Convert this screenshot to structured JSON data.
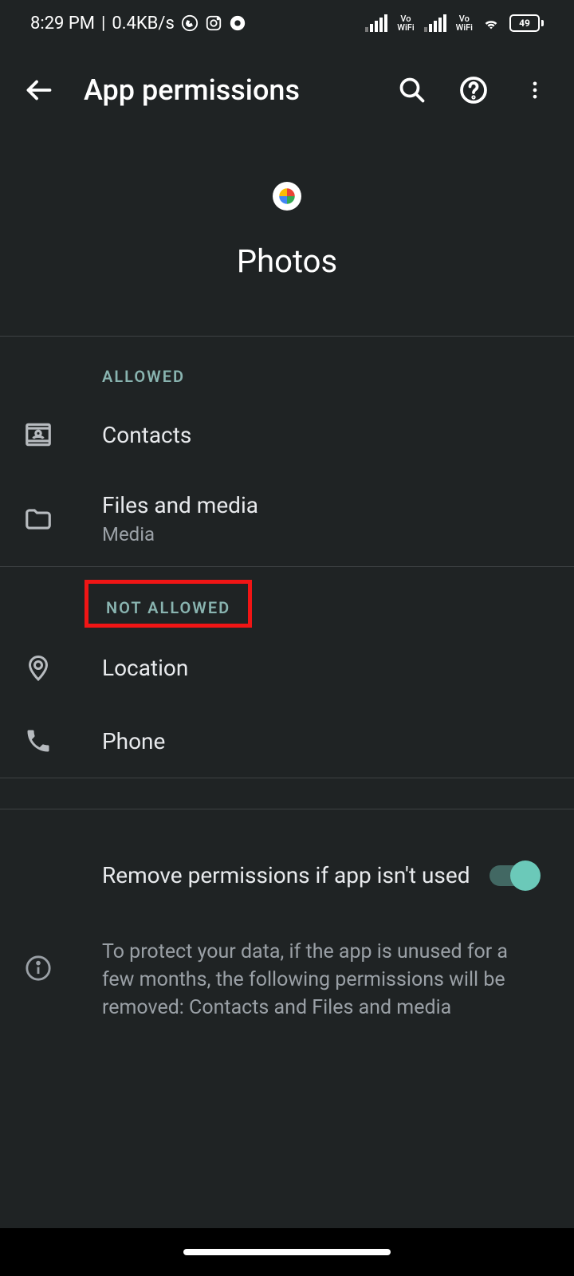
{
  "status_bar": {
    "time": "8:29 PM",
    "data_speed": "0.4KB/s",
    "battery_level": "49"
  },
  "toolbar": {
    "title": "App permissions"
  },
  "app": {
    "name": "Photos"
  },
  "sections": {
    "allowed_label": "ALLOWED",
    "not_allowed_label": "NOT ALLOWED"
  },
  "permissions": {
    "allowed": [
      {
        "title": "Contacts",
        "sub": ""
      },
      {
        "title": "Files and media",
        "sub": "Media"
      }
    ],
    "not_allowed": [
      {
        "title": "Location",
        "sub": ""
      },
      {
        "title": "Phone",
        "sub": ""
      }
    ]
  },
  "remove_permissions": {
    "label": "Remove permissions if app isn't used",
    "enabled": true
  },
  "info_text": "To protect your data, if the app is unused for a few months, the following permissions will be removed: Contacts and Files and media"
}
